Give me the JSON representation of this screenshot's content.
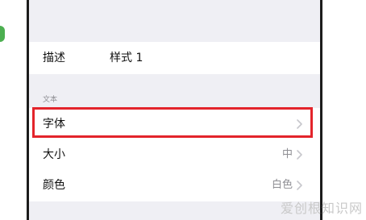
{
  "description_row": {
    "label": "描述",
    "value": "样式 1"
  },
  "text_section": {
    "header": "文本",
    "rows": [
      {
        "label": "字体",
        "value": ""
      },
      {
        "label": "大小",
        "value": "中"
      },
      {
        "label": "颜色",
        "value": "白色"
      }
    ]
  },
  "watermark": "爱创根知识网",
  "colors": {
    "highlight": "#e3242b",
    "background": "#efeff4",
    "chevron": "#c7c7cc"
  }
}
